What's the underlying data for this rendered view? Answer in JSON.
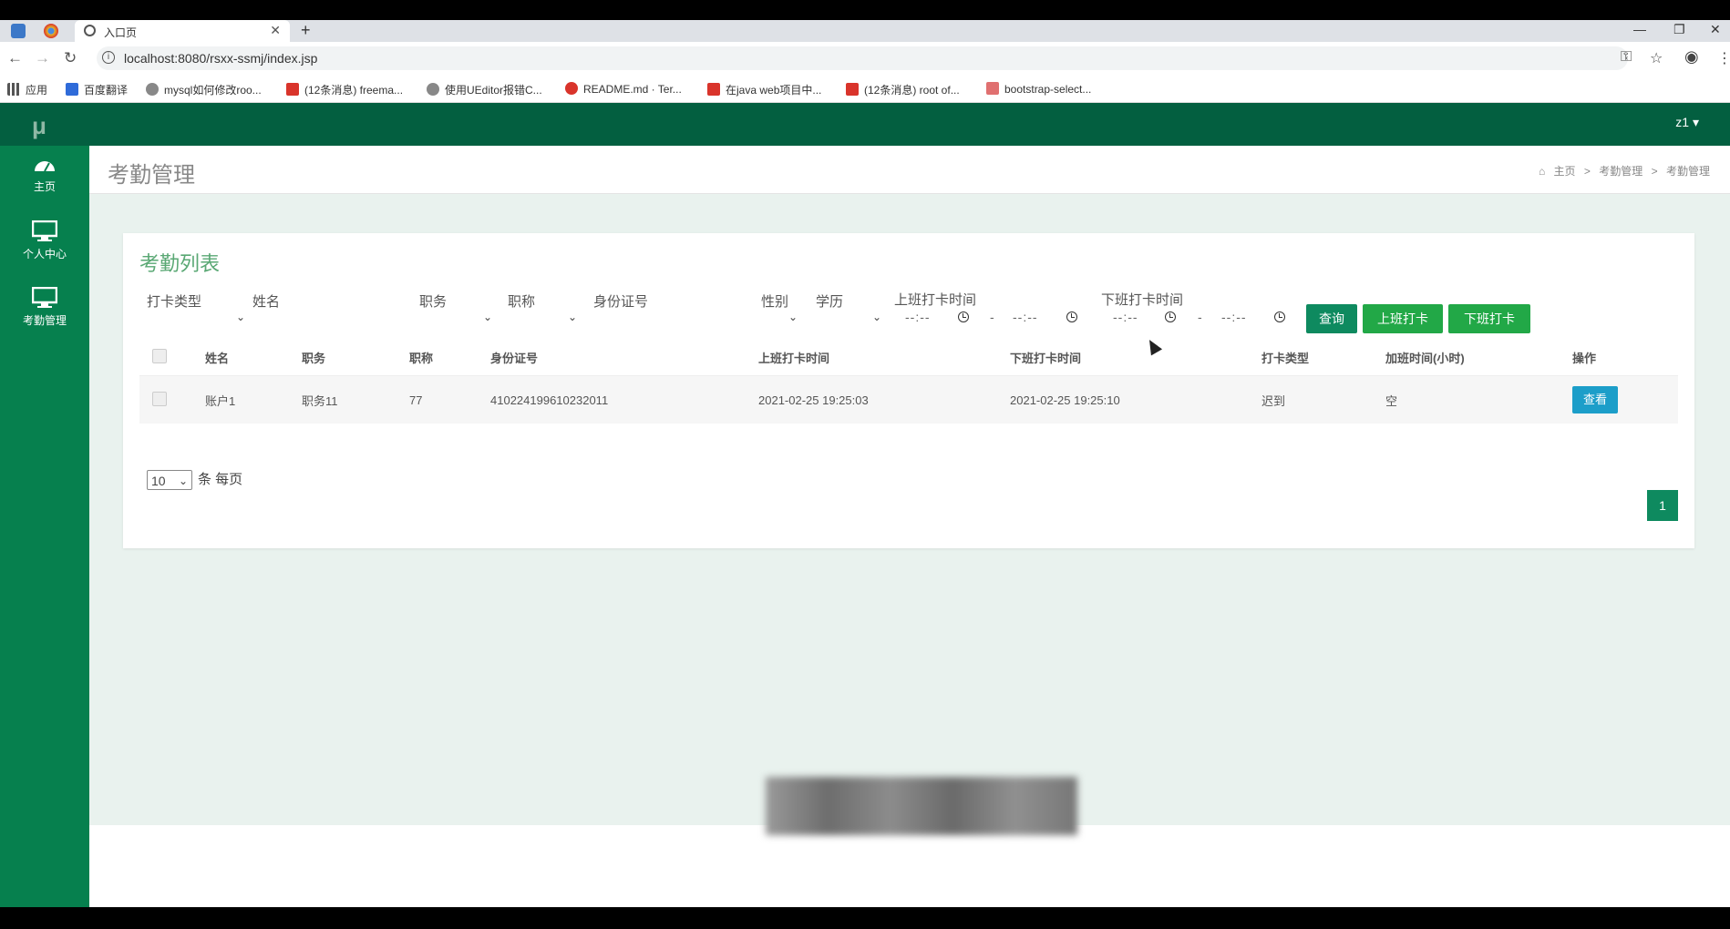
{
  "browser": {
    "tab_title": "入口页",
    "new_tab": "+",
    "url": "localhost:8080/rsxx-ssmj/index.jsp",
    "bookmarks": [
      {
        "label": "应用",
        "color": "#555555"
      },
      {
        "label": "百度翻译",
        "color": "#2f6bd9"
      },
      {
        "label": "mysql如何修改roo...",
        "color": "#666666"
      },
      {
        "label": "(12条消息) freema...",
        "color": "#d9342b"
      },
      {
        "label": "使用UEditor报错C...",
        "color": "#666666"
      },
      {
        "label": "README.md · Ter...",
        "color": "#d9342b"
      },
      {
        "label": "在java web项目中...",
        "color": "#d9342b"
      },
      {
        "label": "(12条消息) root of...",
        "color": "#d9342b"
      },
      {
        "label": "bootstrap-select...",
        "color": "#d9342b"
      }
    ]
  },
  "app": {
    "logo": "μ",
    "user": "z1 ▾",
    "sidebar": [
      {
        "label": "主页",
        "icon": "dashboard-icon"
      },
      {
        "label": "个人中心",
        "icon": "monitor-icon"
      },
      {
        "label": "考勤管理",
        "icon": "monitor-icon"
      }
    ],
    "page_title": "考勤管理",
    "breadcrumb": [
      "主页",
      ">",
      "考勤管理",
      ">",
      "考勤管理"
    ],
    "panel_title": "考勤列表",
    "filters": {
      "punch_type": "打卡类型",
      "name": "姓名",
      "position": "职务",
      "title": "职称",
      "id_number": "身份证号",
      "gender": "性别",
      "education": "学历",
      "clock_in_time": "上班打卡时间",
      "clock_out_time": "下班打卡时间",
      "time_placeholder": "--:--",
      "range_sep": "-"
    },
    "buttons": {
      "search": "查询",
      "clock_in": "上班打卡",
      "clock_out": "下班打卡"
    },
    "table": {
      "columns": [
        "姓名",
        "职务",
        "职称",
        "身份证号",
        "上班打卡时间",
        "下班打卡时间",
        "打卡类型",
        "加班时间(小时)",
        "操作"
      ],
      "rows": [
        {
          "name": "账户1",
          "position": "职务11",
          "title": "77",
          "id_number": "410224199610232011",
          "clock_in": "2021-02-25 19:25:03",
          "clock_out": "2021-02-25 19:25:10",
          "type": "迟到",
          "overtime": "空",
          "action": "查看"
        }
      ]
    },
    "page_size": "10",
    "page_size_label": "条 每页",
    "current_page": "1"
  },
  "colors": {
    "topnav": "#035f40",
    "sidebar": "#06804e",
    "btn_search": "#0e8a5f",
    "btn_clock": "#22a847",
    "btn_view": "#1c9ec9"
  }
}
